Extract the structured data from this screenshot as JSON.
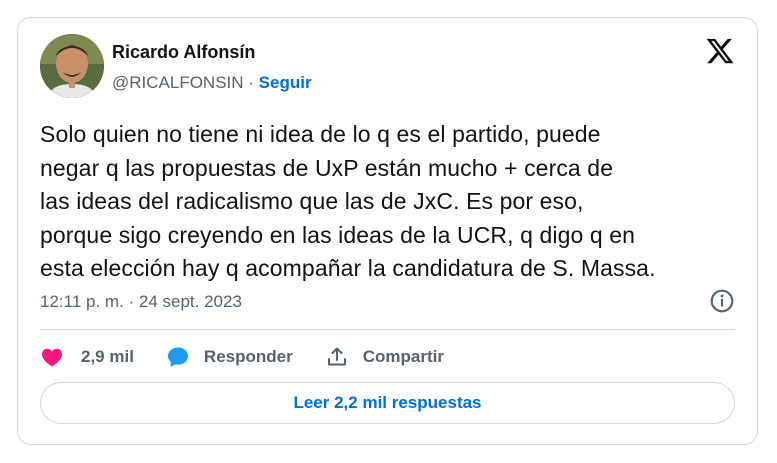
{
  "author": {
    "name": "Ricardo Alfonsín",
    "handle": "@RICALFONSIN",
    "separator": " · ",
    "follow_label": "Seguir"
  },
  "tweet": {
    "text": "Solo quien no tiene ni idea de lo q es el partido, puede\nnegar q las propuestas de UxP están  mucho + cerca de\nlas ideas del radicalismo que las de JxC. Es por eso,\nporque sigo creyendo en las ideas de la UCR,  q digo q en\nesta elección hay q acompañar la candidatura de S. Massa.",
    "timestamp": "12:11 p. m. · 24 sept. 2023"
  },
  "actions": {
    "likes": "2,9 mil",
    "reply_label": "Responder",
    "share_label": "Compartir"
  },
  "read_replies_label": "Leer 2,2 mil respuestas",
  "icons": {
    "brand": "x-logo-icon",
    "info": "info-icon",
    "like": "heart-icon",
    "reply": "reply-bubble-icon",
    "share": "share-icon"
  },
  "colors": {
    "link": "#006fd6",
    "heart": "#f91880",
    "reply_bubble": "#1d9bf0",
    "muted": "#536471",
    "border": "#cfd9de"
  }
}
